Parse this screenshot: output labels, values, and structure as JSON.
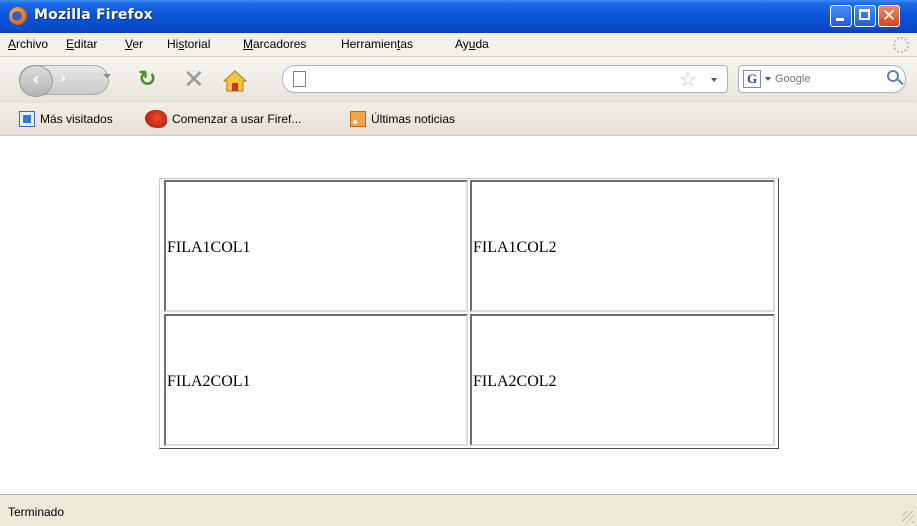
{
  "window": {
    "title": "Mozilla Firefox",
    "controls": {
      "minimize": "",
      "maximize": "",
      "close": "✕"
    }
  },
  "menubar": {
    "items": [
      {
        "label": "Archivo",
        "accesskey_index": 0
      },
      {
        "label": "Editar",
        "accesskey_index": 0
      },
      {
        "label": "Ver",
        "accesskey_index": 0
      },
      {
        "label": "Historial",
        "accesskey_index": 2
      },
      {
        "label": "Marcadores",
        "accesskey_index": 0
      },
      {
        "label": "Herramientas",
        "accesskey_index": 9
      },
      {
        "label": "Ayuda",
        "accesskey_index": 2
      }
    ]
  },
  "navbar": {
    "url_value": "",
    "search_engine": "Google",
    "search_placeholder": "Google",
    "icons": [
      "back-icon",
      "forward-icon",
      "reload-icon",
      "stop-icon",
      "home-icon",
      "page-icon",
      "bookmark-star-icon",
      "search-icon"
    ]
  },
  "bookmarks": {
    "items": [
      {
        "label": "Más visitados",
        "icon": "most-visited-icon"
      },
      {
        "label": "Comenzar a usar Firef...",
        "icon": "firefox-icon"
      },
      {
        "label": "Últimas noticias",
        "icon": "rss-icon"
      }
    ]
  },
  "content": {
    "table": {
      "rows": [
        [
          "FILA1COL1",
          "FILA1COL2"
        ],
        [
          "FILA2COL1",
          "FILA2COL2"
        ]
      ]
    }
  },
  "statusbar": {
    "text": "Terminado"
  },
  "colors": {
    "titlebar": "#0a56d8",
    "close_button": "#d2451f",
    "chrome": "#ece9d8"
  }
}
